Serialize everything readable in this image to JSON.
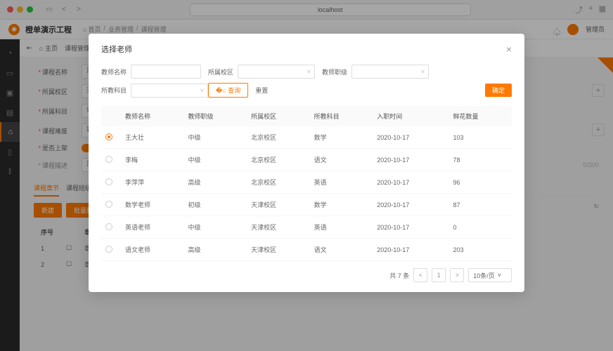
{
  "browser": {
    "url": "localhost"
  },
  "app": {
    "title": "橙单演示工程",
    "breadcrumbs": [
      "首页",
      "业务管理",
      "课程管理"
    ],
    "user": "管理员"
  },
  "tabs": {
    "home": "主页",
    "current": "课程管理"
  },
  "form": {
    "course_name_label": "课程名称",
    "course_name_value": "测试",
    "campus_label": "所属校区",
    "campus_value": "天津",
    "subject_label": "所属科目",
    "subject_value": "语文",
    "difficulty_label": "课程难度",
    "difficulty_value": "容易",
    "on_shelf_label": "是否上架",
    "desc_label": "课程描述",
    "desc_value": "测试",
    "desc_counter": "0/300"
  },
  "sub_tabs": {
    "chapter": "课程章节",
    "class": "课程班级"
  },
  "actions": {
    "new": "新建",
    "batch": "批量删"
  },
  "refresh_icon": "↻",
  "small_table": {
    "col1": "序号",
    "col2": "章节",
    "r1": "1",
    "r1c": "章节",
    "r2": "2",
    "r2c": "章节"
  },
  "modal": {
    "title": "选择老师",
    "filters": {
      "name_label": "教师名称",
      "campus_label": "所属校区",
      "level_label": "教师职级",
      "subject_label": "所教科目",
      "search": "查询",
      "reset": "重置",
      "confirm": "确定"
    },
    "columns": {
      "name": "教师名称",
      "level": "教师职级",
      "campus": "所属校区",
      "subject": "所教科目",
      "date": "入职时间",
      "flowers": "鲜花数量"
    },
    "rows": [
      {
        "name": "王大壮",
        "level": "中级",
        "campus": "北京校区",
        "subject": "数学",
        "date": "2020-10-17",
        "flowers": "103",
        "selected": true
      },
      {
        "name": "李梅",
        "level": "中级",
        "campus": "北京校区",
        "subject": "语文",
        "date": "2020-10-17",
        "flowers": "78"
      },
      {
        "name": "李萍萍",
        "level": "高级",
        "campus": "北京校区",
        "subject": "英语",
        "date": "2020-10-17",
        "flowers": "96"
      },
      {
        "name": "数学老师",
        "level": "初级",
        "campus": "天津校区",
        "subject": "数学",
        "date": "2020-10-17",
        "flowers": "87"
      },
      {
        "name": "英语老师",
        "level": "中级",
        "campus": "天津校区",
        "subject": "英语",
        "date": "2020-10-17",
        "flowers": "0"
      },
      {
        "name": "语文老师",
        "level": "高级",
        "campus": "天津校区",
        "subject": "语文",
        "date": "2020-10-17",
        "flowers": "203"
      }
    ],
    "pager": {
      "total": "共 7 条",
      "page": "1",
      "size": "10条/页"
    }
  }
}
